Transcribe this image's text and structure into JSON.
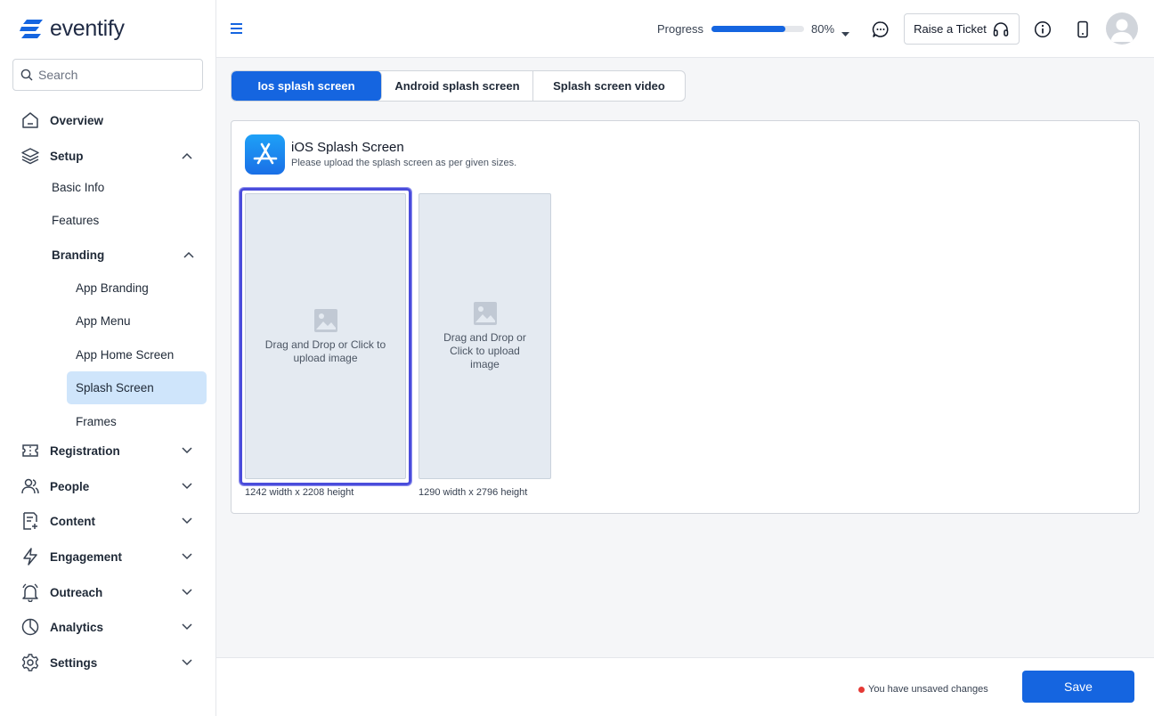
{
  "brand": {
    "name": "eventify",
    "accent": "#1565e0"
  },
  "search": {
    "placeholder": "Search"
  },
  "sidebar": {
    "overview": "Overview",
    "setup": "Setup",
    "setup_items": {
      "basic_info": "Basic Info",
      "features": "Features",
      "branding": "Branding"
    },
    "branding_items": {
      "app_branding": "App Branding",
      "app_menu": "App Menu",
      "app_home_screen": "App Home Screen",
      "splash_screen": "Splash Screen",
      "frames": "Frames"
    },
    "registration": "Registration",
    "people": "People",
    "content": "Content",
    "engagement": "Engagement",
    "outreach": "Outreach",
    "analytics": "Analytics",
    "settings": "Settings",
    "active_item": "Splash Screen"
  },
  "header": {
    "progress_label": "Progress",
    "progress_value": 80,
    "progress_text": "80%",
    "ticket_label": "Raise a Ticket"
  },
  "tabs": {
    "ios": "Ios splash screen",
    "android": "Android splash screen",
    "video": "Splash screen video",
    "active": "Ios splash screen"
  },
  "card": {
    "title": "iOS Splash Screen",
    "subtitle": "Please upload the splash screen as per given sizes.",
    "upload1_text": "Drag and Drop or Click to upload image",
    "upload1_size": "1242 width x 2208 height",
    "upload2_text": "Drag and Drop or Click to upload image",
    "upload2_size": "1290 width x 2796 height"
  },
  "footer": {
    "unsaved": "You have unsaved changes",
    "save": "Save"
  }
}
